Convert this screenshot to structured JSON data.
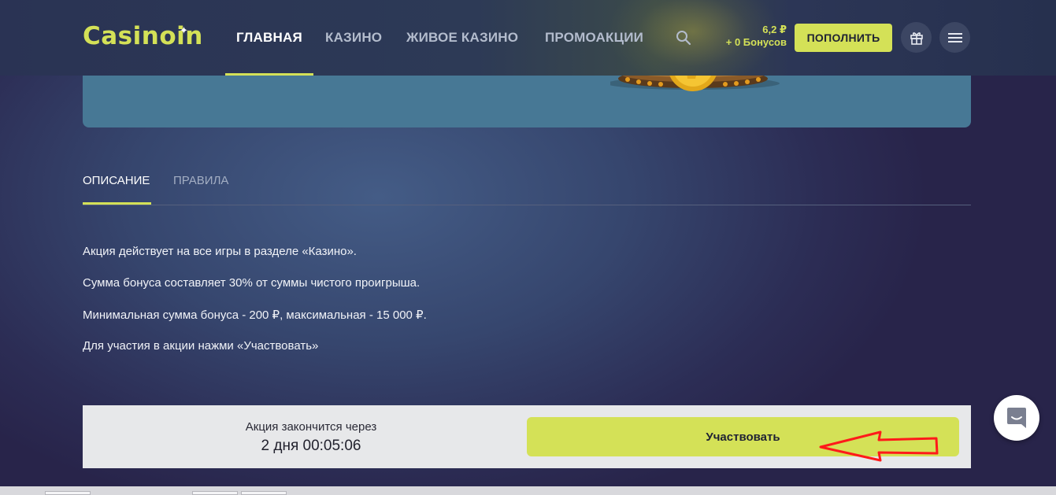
{
  "header": {
    "logo": "Casinoin",
    "nav": [
      {
        "label": "ГЛАВНАЯ",
        "active": true
      },
      {
        "label": "КАЗИНО",
        "active": false
      },
      {
        "label": "ЖИВОЕ КАЗИНО",
        "active": false
      },
      {
        "label": "ПРОМОАКЦИИ",
        "active": false
      }
    ],
    "balance": "6,2 ₽",
    "bonus": "+ 0 Бонусов",
    "topup_label": "ПОПОЛНИТЬ",
    "icons": [
      "search-icon",
      "gift-icon",
      "menu-icon"
    ],
    "accent_color": "#d4e157"
  },
  "tabs": [
    {
      "label": "ОПИСАНИЕ",
      "active": true
    },
    {
      "label": "ПРАВИЛА",
      "active": false
    }
  ],
  "description": [
    "Акция действует на все игры в разделе «Казино».",
    "Сумма бонуса составляет 30% от суммы чистого проигрыша.",
    "Минимальная сумма бонуса - 200 ₽, максимальная - 15 000 ₽.",
    "Для участия в акции нажми «Участвовать»"
  ],
  "footer": {
    "ends_label": "Акция закончится через",
    "ends_value": "2 дня 00:05:06",
    "participate_label": "Участвовать"
  },
  "chat": {
    "icon": "chat-icon"
  },
  "annotation": {
    "color": "#ff1a1a",
    "icon": "red-arrow-annotation"
  }
}
